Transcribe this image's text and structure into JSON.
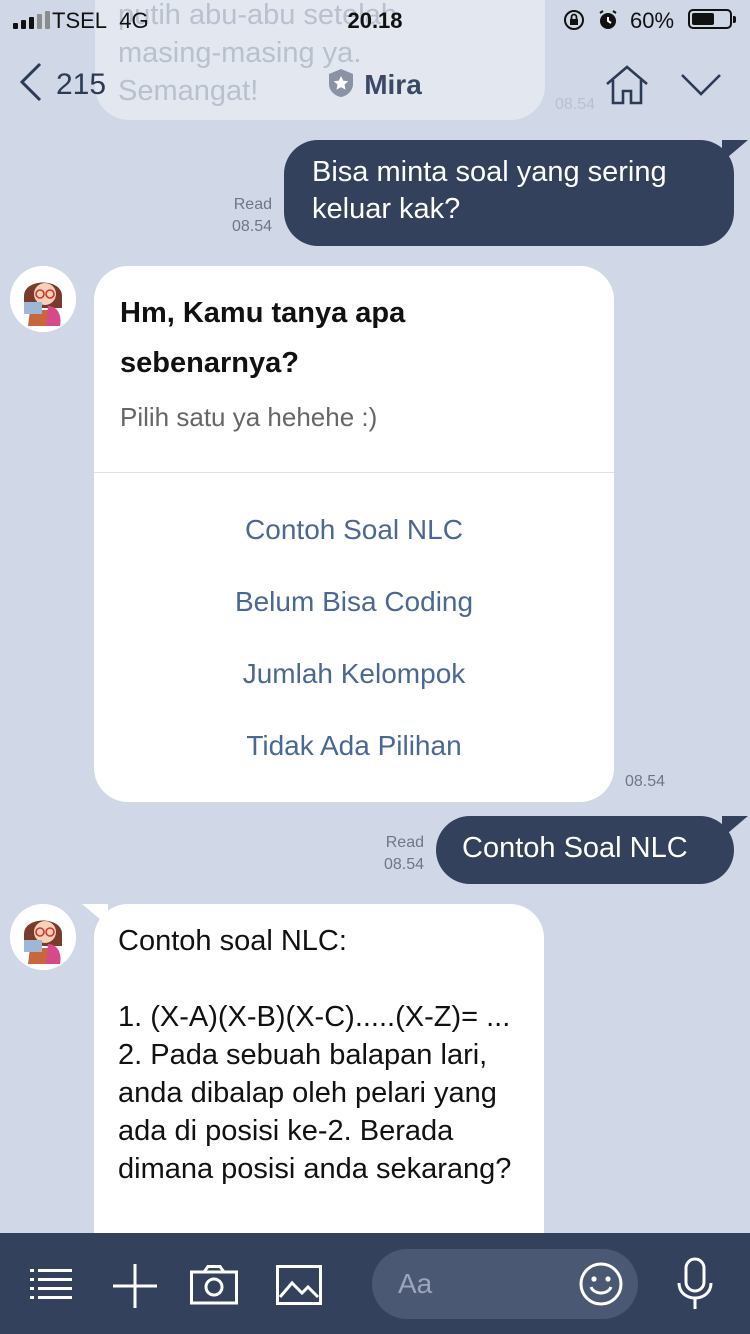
{
  "status_bar": {
    "carrier": "TSEL",
    "network": "4G",
    "time": "20.18",
    "battery_percent": "60%",
    "battery_level": 0.6,
    "icons": [
      "signal-bars",
      "rotation-lock-icon",
      "alarm-icon",
      "battery-icon"
    ]
  },
  "header": {
    "back_count": "215",
    "title": "Mira",
    "icons": [
      "back-chevron-icon",
      "official-star-badge-icon",
      "home-icon",
      "chevron-down-icon"
    ]
  },
  "background_message": {
    "lines": "putih abu-abu setelah\nmasing-masing ya.\nSemangat!",
    "time": "08.54"
  },
  "messages": {
    "out1": {
      "text": "Bisa minta soal yang sering keluar kak?",
      "read": "Read",
      "time": "08.54"
    },
    "card": {
      "title": "Hm, Kamu tanya apa sebenarnya?",
      "subtitle": "Pilih satu ya hehehe :)",
      "options": [
        "Contoh Soal NLC",
        "Belum Bisa Coding",
        "Jumlah Kelompok",
        "Tidak Ada Pilihan"
      ],
      "time": "08.54"
    },
    "out2": {
      "text": "Contoh Soal NLC",
      "read": "Read",
      "time": "08.54"
    },
    "in1": {
      "text": "Contoh soal NLC:\n\n1. (X-A)(X-B)(X-C).....(X-Z)= ...\n2. Pada sebuah balapan lari, anda dibalap oleh pelari yang ada di posisi ke-2. Berada dimana posisi anda sekarang?"
    }
  },
  "input_bar": {
    "placeholder": "Aa",
    "icons": [
      "menu-icon",
      "plus-icon",
      "camera-icon",
      "image-icon",
      "emoji-icon",
      "microphone-icon"
    ]
  },
  "colors": {
    "background": "#d0d7e6",
    "outgoing_bubble": "#33415c",
    "option_link": "#4a6894",
    "bottom_bar": "#33415c"
  }
}
